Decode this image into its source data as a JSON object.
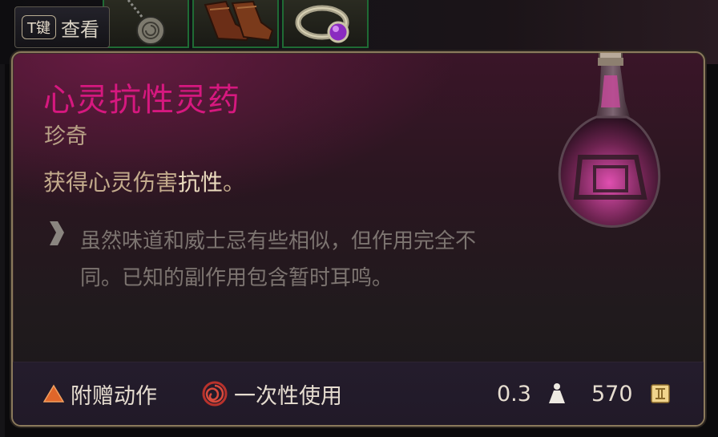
{
  "background": {
    "hint_key": "T键",
    "hint_label": "查看",
    "slots": [
      "amulet-icon",
      "boots-icon",
      "ring-icon"
    ]
  },
  "tooltip": {
    "title": "心灵抗性灵药",
    "rarity": "珍奇",
    "effect_prefix": "获得心灵伤害",
    "effect_highlight": "抗性",
    "effect_suffix": "。",
    "flavor_text": "虽然味道和威士忌有些相似，但作用完全不同。已知的副作用包含暂时耳鸣。",
    "footer": {
      "action_type": "附赠动作",
      "usage": "一次性使用",
      "weight": "0.3",
      "value": "570"
    }
  },
  "colors": {
    "title": "#d6187f",
    "rarity": "#b9a287",
    "effect_text": "#c3ab8c",
    "effect_highlight": "#ecdcbf",
    "flavor_text": "#7c7470",
    "slot_border": "#1f6b34",
    "frame_border": "#8b7a5c",
    "bonus_action": "#e0662a",
    "one_use": "#b8322c",
    "footer_bg": "#231c2a"
  }
}
